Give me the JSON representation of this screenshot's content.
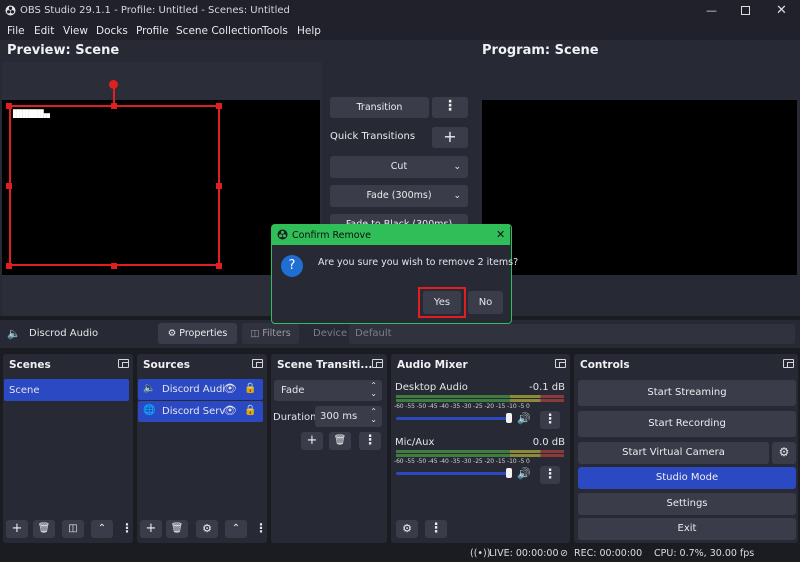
{
  "window": {
    "title": "OBS Studio 29.1.1 - Profile: Untitled - Scenes: Untitled",
    "controls": [
      "minimize",
      "maximize",
      "close"
    ]
  },
  "menu": [
    "File",
    "Edit",
    "View",
    "Docks",
    "Profile",
    "Scene Collection",
    "Tools",
    "Help"
  ],
  "preview": {
    "title": "Preview: Scene"
  },
  "program": {
    "title": "Program: Scene"
  },
  "transitions_panel": {
    "transition_label": "Transition",
    "quick_transitions_label": "Quick Transitions",
    "items": [
      "Cut",
      "Fade (300ms)",
      "Fade to Black (300ms)"
    ]
  },
  "source_toolbar": {
    "source_name": "Discrod Audio",
    "properties_label": "Properties",
    "filters_label": "Filters",
    "device_label": "Device",
    "device_value": "Default"
  },
  "dialog": {
    "title": "Confirm Remove",
    "message": "Are you sure you wish to remove 2 items?",
    "yes_label": "Yes",
    "no_label": "No"
  },
  "docks": {
    "scenes": {
      "title": "Scenes",
      "items": [
        "Scene"
      ]
    },
    "sources": {
      "title": "Sources",
      "items": [
        "Discord Audi",
        "Discord Serv"
      ]
    },
    "scene_transitions": {
      "title": "Scene Transiti...",
      "transition": "Fade",
      "duration_label": "Duration",
      "duration_value": "300 ms"
    },
    "audio_mixer": {
      "title": "Audio Mixer",
      "tick_labels": "-60 -55 -50 -45 -40 -35 -30 -25 -20 -15 -10 -5 0",
      "channels": [
        {
          "name": "Desktop Audio",
          "level": "-0.1 dB",
          "volume": 1.0
        },
        {
          "name": "Mic/Aux",
          "level": "0.0 dB",
          "volume": 1.0
        }
      ]
    },
    "controls": {
      "title": "Controls",
      "start_streaming": "Start Streaming",
      "start_recording": "Start Recording",
      "start_virtual_camera": "Start Virtual Camera",
      "studio_mode": "Studio Mode",
      "settings": "Settings",
      "exit": "Exit"
    }
  },
  "status": {
    "live": "LIVE: 00:00:00",
    "rec": "REC: 00:00:00",
    "cpu": "CPU: 0.7%, 30.00 fps"
  },
  "colors": {
    "accent": "#2c49c4",
    "selection": "#e02020",
    "dialog_border": "#2fbe58",
    "yes_highlight": "#e02020"
  }
}
